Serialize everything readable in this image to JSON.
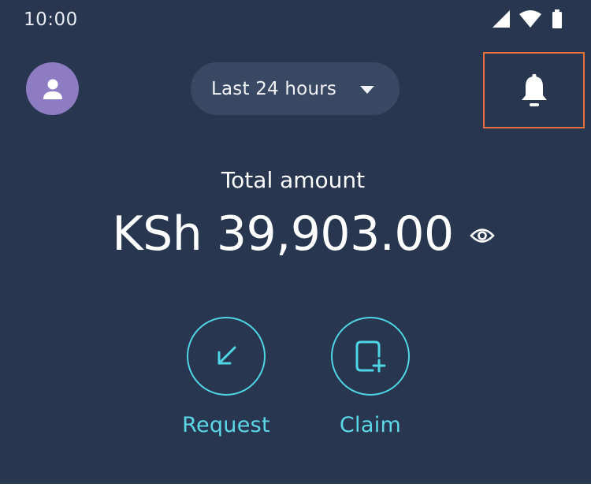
{
  "status_bar": {
    "time": "10:00",
    "icons": [
      "cellular-signal-icon",
      "wifi-icon",
      "battery-icon"
    ]
  },
  "header": {
    "avatar_icon": "person-icon",
    "period_select": {
      "selected": "Last 24 hours",
      "icon": "caret-down-icon"
    },
    "notification_icon": "bell-icon"
  },
  "balance": {
    "label": "Total amount",
    "amount": "KSh 39,903.00",
    "visibility_icon": "eye-icon"
  },
  "actions": [
    {
      "label": "Request",
      "icon": "arrow-down-left-icon"
    },
    {
      "label": "Claim",
      "icon": "square-plus-icon"
    }
  ],
  "colors": {
    "background": "#283650",
    "pill": "#3a4963",
    "avatar": "#8e7cc3",
    "accent": "#4fd5e3",
    "highlight": "#e4703f"
  }
}
